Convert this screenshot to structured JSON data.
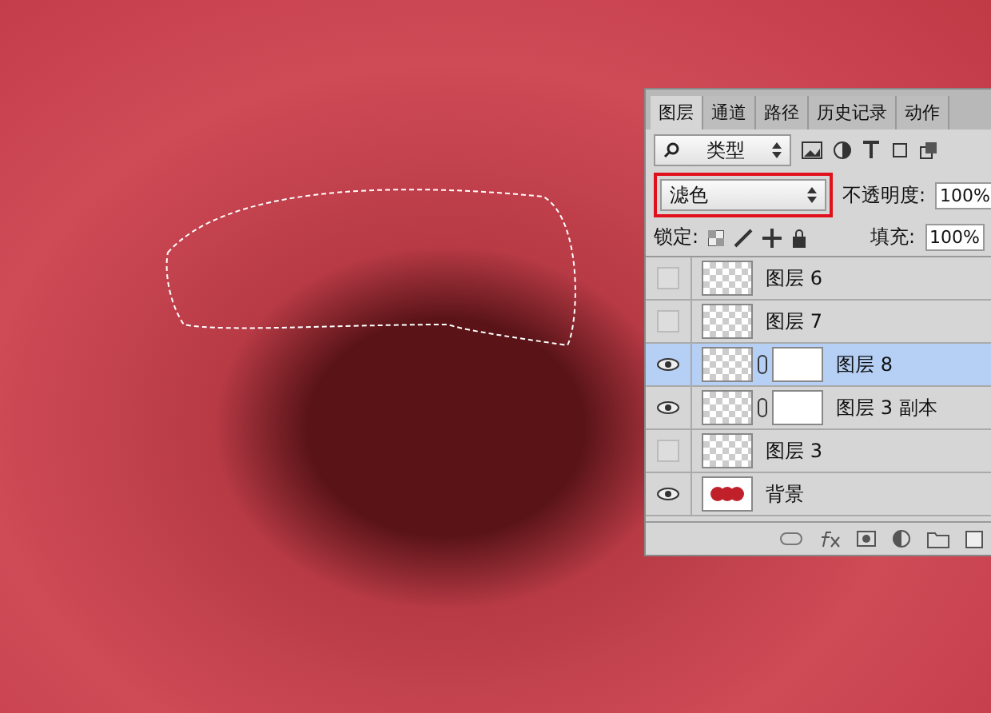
{
  "tabs": [
    {
      "label": "图层",
      "selected": true
    },
    {
      "label": "通道",
      "selected": false
    },
    {
      "label": "路径",
      "selected": false
    },
    {
      "label": "历史记录",
      "selected": false
    },
    {
      "label": "动作",
      "selected": false
    }
  ],
  "filter": {
    "value": "类型"
  },
  "blend_mode": {
    "value": "滤色",
    "highlighted": true
  },
  "opacity": {
    "label": "不透明度:",
    "value": "100%"
  },
  "lock": {
    "label": "锁定:"
  },
  "fill": {
    "label": "填充:",
    "value": "100%"
  },
  "layers": [
    {
      "name": "图层 6",
      "visible": false,
      "selected": false,
      "mask": false,
      "kind": "transparent"
    },
    {
      "name": "图层 7",
      "visible": false,
      "selected": false,
      "mask": false,
      "kind": "transparent"
    },
    {
      "name": "图层 8",
      "visible": true,
      "selected": true,
      "mask": true,
      "kind": "transparent"
    },
    {
      "name": "图层 3 副本",
      "visible": true,
      "selected": false,
      "mask": true,
      "kind": "transparent"
    },
    {
      "name": "图层 3",
      "visible": false,
      "selected": false,
      "mask": false,
      "kind": "transparent"
    },
    {
      "name": "背景",
      "visible": true,
      "selected": false,
      "mask": false,
      "kind": "photo"
    }
  ]
}
